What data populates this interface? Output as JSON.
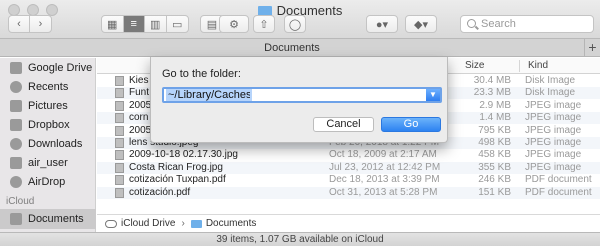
{
  "window": {
    "title": "Documents"
  },
  "toolbar": {
    "search_placeholder": "Search"
  },
  "tabbar": {
    "tab_label": "Documents",
    "add_label": "+"
  },
  "sidebar": {
    "items": [
      {
        "label": "Google Drive",
        "icon": "google-drive-icon"
      },
      {
        "label": "Recents",
        "icon": "clock-icon"
      },
      {
        "label": "Pictures",
        "icon": "pictures-icon"
      },
      {
        "label": "Dropbox",
        "icon": "dropbox-icon"
      },
      {
        "label": "Downloads",
        "icon": "downloads-icon"
      },
      {
        "label": "air_user",
        "icon": "home-icon"
      },
      {
        "label": "AirDrop",
        "icon": "airdrop-icon"
      }
    ],
    "section_icloud": "iCloud",
    "icloud_items": [
      {
        "label": "Documents",
        "icon": "documents-icon",
        "selected": true
      }
    ]
  },
  "list": {
    "columns": {
      "size": "Size",
      "kind": "Kind"
    },
    "rows": [
      {
        "name": "Kies",
        "date": "",
        "size": "30.4 MB",
        "kind": "Disk Image"
      },
      {
        "name": "Funt",
        "date": "",
        "size": "23.3 MB",
        "kind": "Disk Image"
      },
      {
        "name": "2005",
        "date": "",
        "size": "2.9 MB",
        "kind": "JPEG image"
      },
      {
        "name": "corn",
        "date": "",
        "size": "1.4 MB",
        "kind": "JPEG image"
      },
      {
        "name": "2005",
        "date": "",
        "size": "795 KB",
        "kind": "JPEG image"
      },
      {
        "name": "lens studio.jpeg",
        "date": "Feb 20, 2018 at 1:22 PM",
        "size": "498 KB",
        "kind": "JPEG image"
      },
      {
        "name": "2009-10-18 02.17.30.jpg",
        "date": "Oct 18, 2009 at 2:17 AM",
        "size": "458 KB",
        "kind": "JPEG image"
      },
      {
        "name": "Costa Rican Frog.jpg",
        "date": "Jul 23, 2012 at 12:42 PM",
        "size": "355 KB",
        "kind": "JPEG image"
      },
      {
        "name": "cotización Tuxpan.pdf",
        "date": "Dec 18, 2013 at 3:39 PM",
        "size": "246 KB",
        "kind": "PDF document"
      },
      {
        "name": "cotización.pdf",
        "date": "Oct 31, 2013 at 5:28 PM",
        "size": "151 KB",
        "kind": "PDF document"
      }
    ]
  },
  "pathbar": {
    "root": "iCloud Drive",
    "sep": "›",
    "current": "Documents"
  },
  "status": {
    "text": "39 items, 1.07 GB available on iCloud"
  },
  "dialog": {
    "label": "Go to the folder:",
    "value": "~/Library/Caches",
    "cancel": "Cancel",
    "go": "Go"
  },
  "colors": {
    "accent": "#2d82f1",
    "selection": "#b6d4fb"
  }
}
